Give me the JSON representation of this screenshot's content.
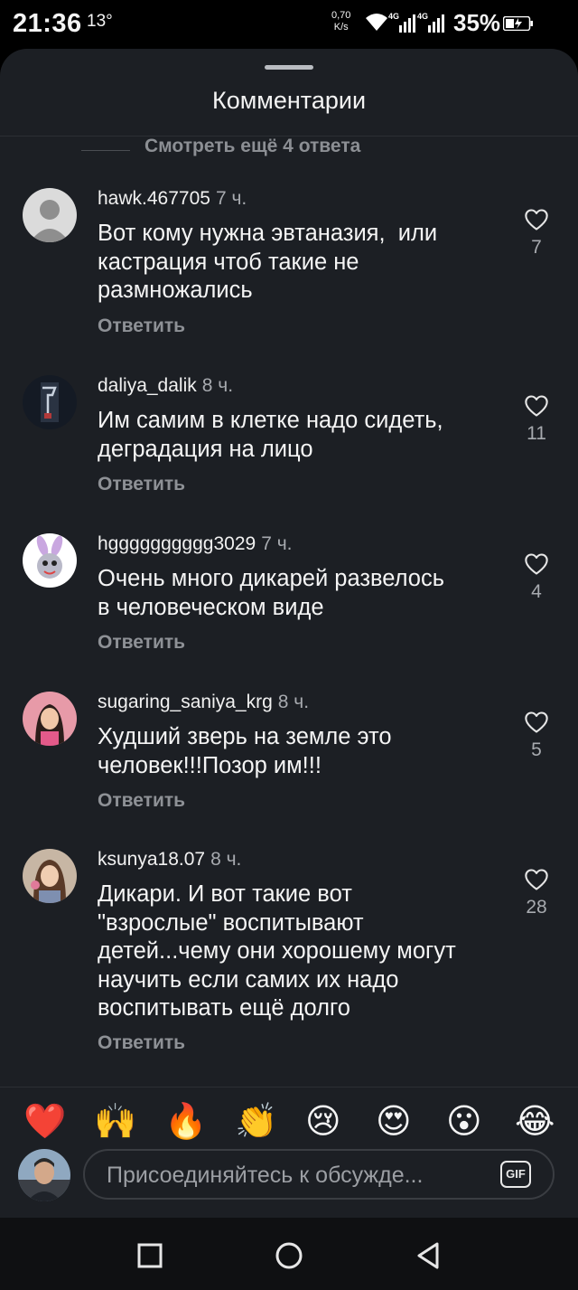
{
  "status_bar": {
    "time": "21:36",
    "temperature": "13°",
    "net_speed_value": "0,70",
    "net_speed_unit": "K/s",
    "network_type_1": "4G",
    "network_type_2": "4G",
    "battery": "35%"
  },
  "sheet": {
    "title": "Комментарии",
    "view_more": "Смотреть ещё 4 ответа"
  },
  "comments": [
    {
      "user": "hawk.467705",
      "time": "7 ч.",
      "text": "Вот кому нужна эвтаназия,  или\nкастрация чтоб такие не\nразмножались",
      "reply": "Ответить",
      "likes": "7"
    },
    {
      "user": "daliya_dalik",
      "time": "8 ч.",
      "text": "Им самим в клетке надо сидеть,\nдеградация на лицо",
      "reply": "Ответить",
      "likes": "11"
    },
    {
      "user": "hgggggggggg3029",
      "time": "7 ч.",
      "text": "Очень много дикарей развелось\nв человеческом виде",
      "reply": "Ответить",
      "likes": "4"
    },
    {
      "user": "sugaring_saniya_krg",
      "time": "8 ч.",
      "text": "Худший зверь на земле это\nчеловек!!!Позор им!!!",
      "reply": "Ответить",
      "likes": "5"
    },
    {
      "user": "ksunya18.07",
      "time": "8 ч.",
      "text": "Дикари. И вот такие вот\n\"взрослые\" воспитывают\nдетей...чему они хорошему могут\nнаучить если самих их надо\nвоспитывать ещё долго",
      "reply": "Ответить",
      "likes": "28"
    }
  ],
  "emoji_bar": [
    "❤️",
    "🙌",
    "🔥",
    "👏",
    "😢",
    "😍",
    "😮",
    "😂"
  ],
  "composer": {
    "placeholder": "Присоединяйтесь к обсужде...",
    "gif_label": "GIF"
  }
}
